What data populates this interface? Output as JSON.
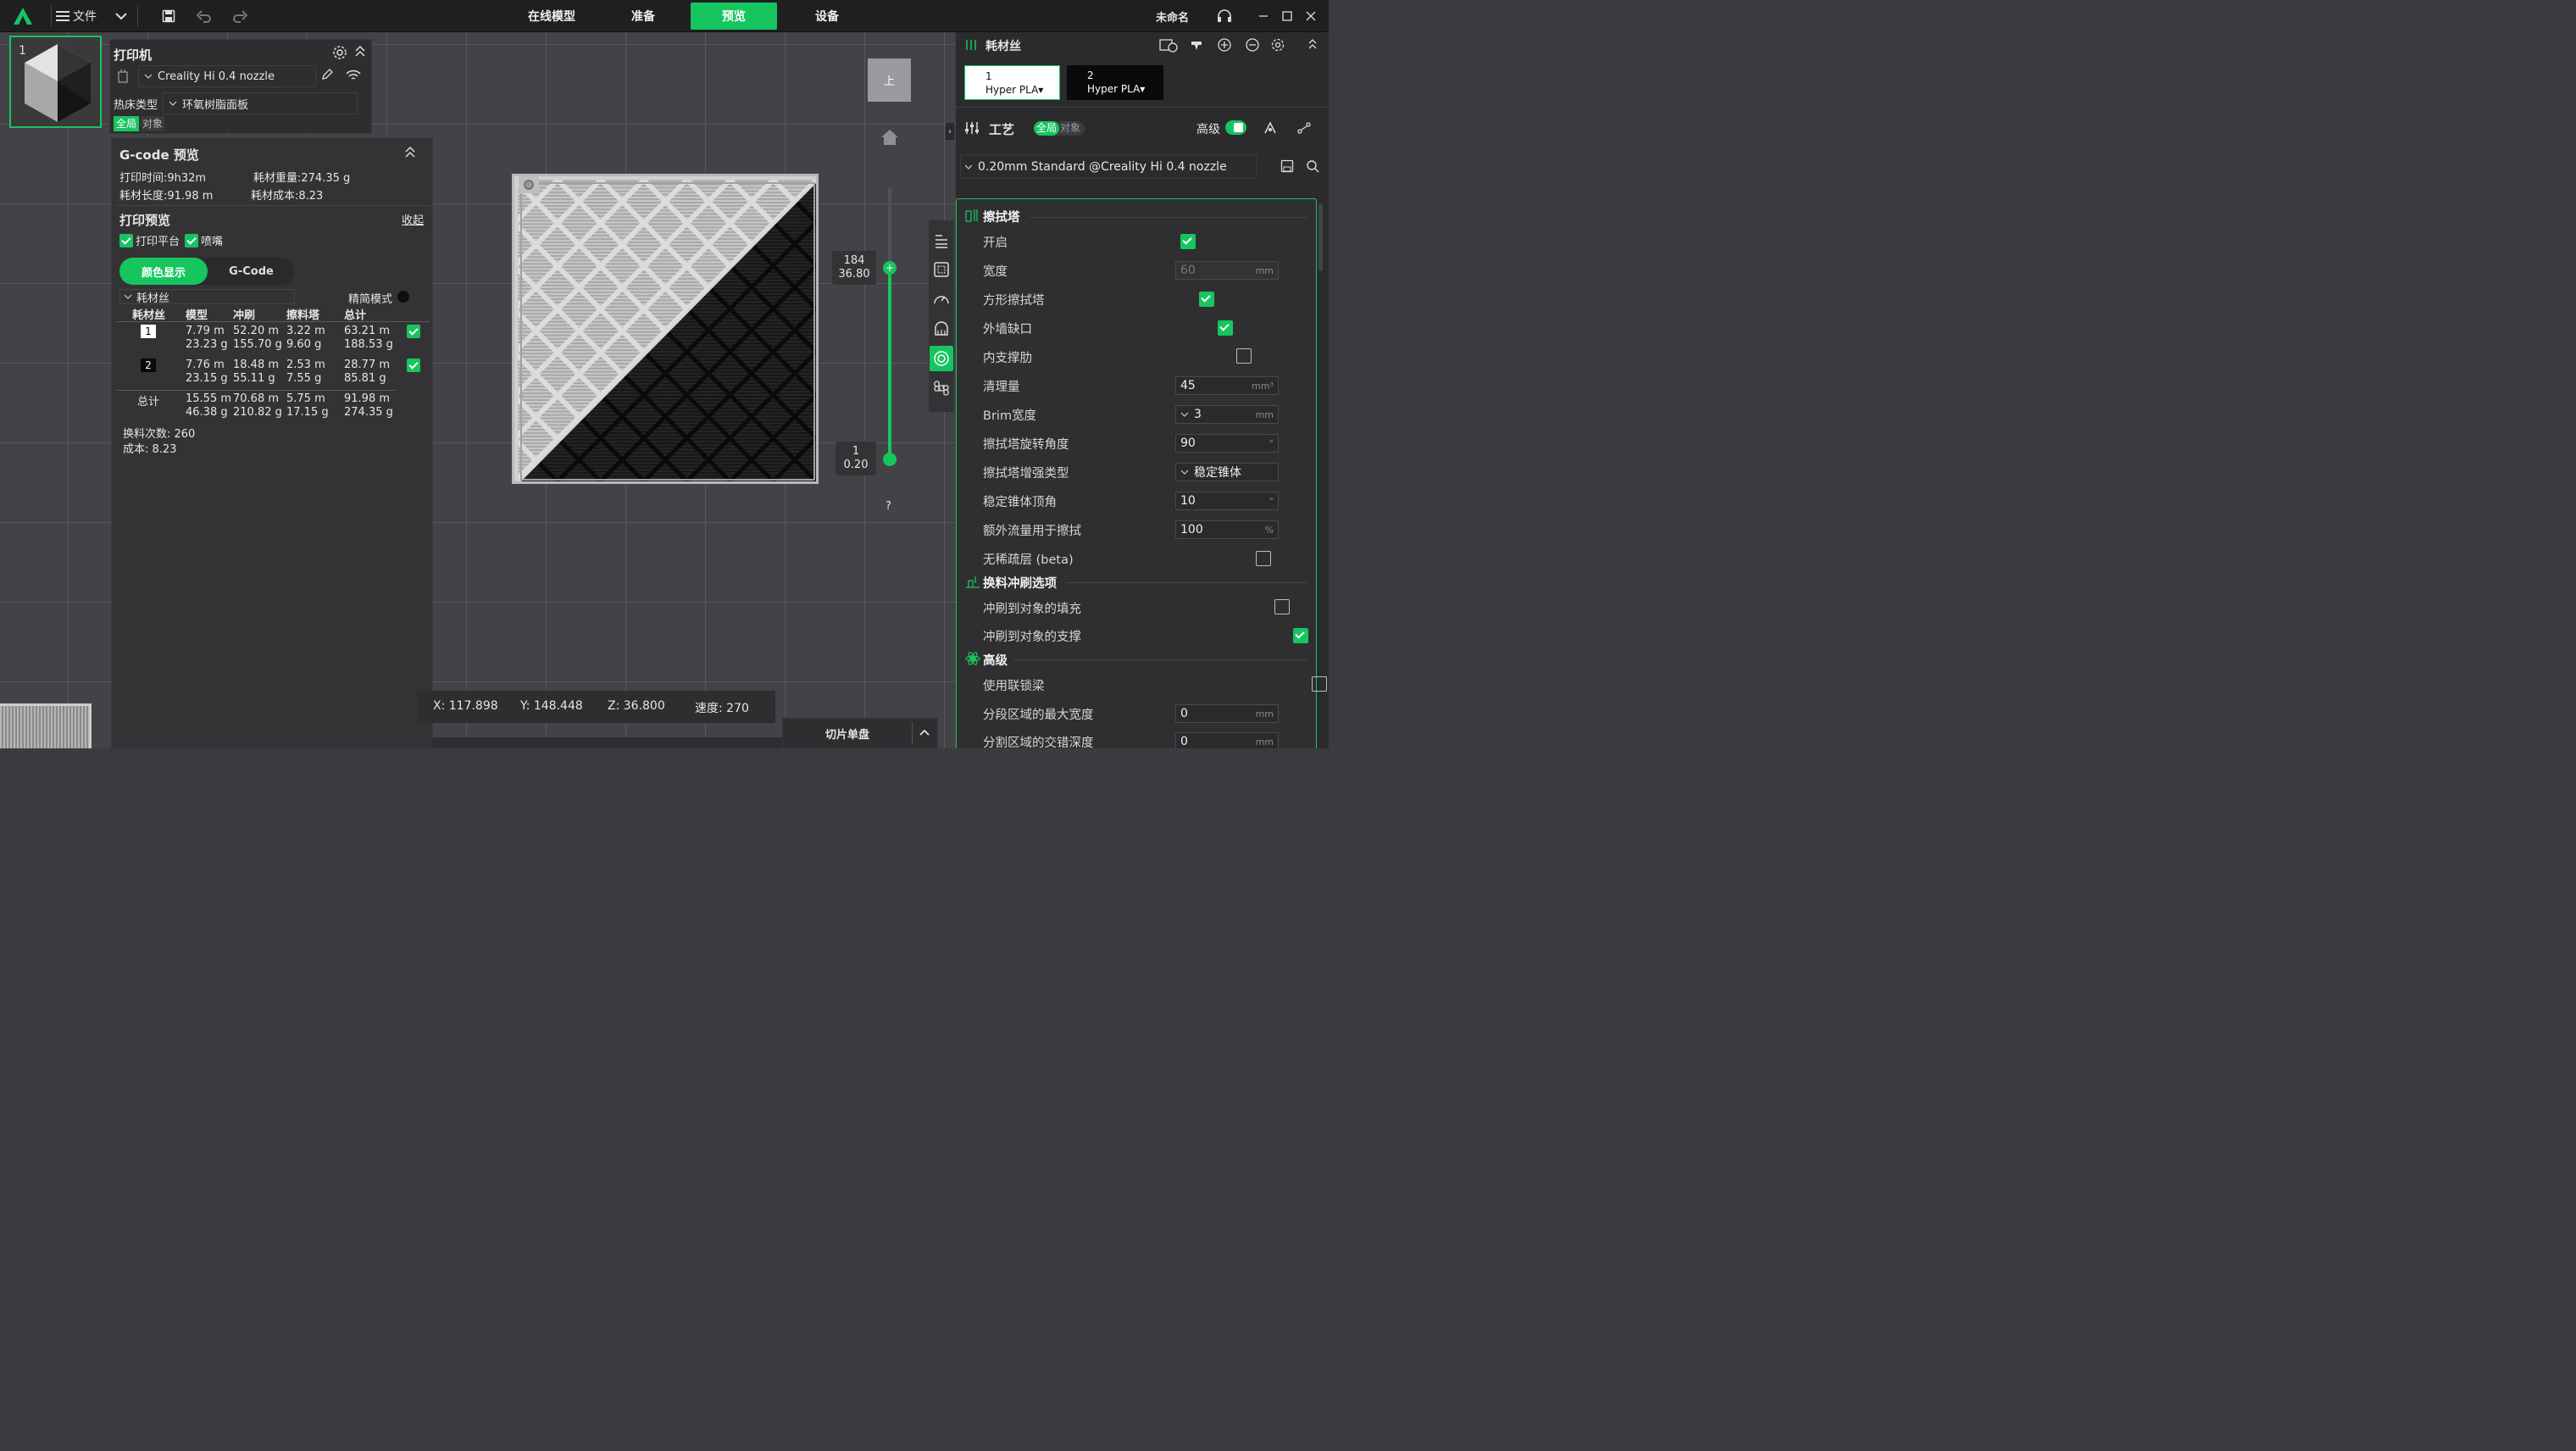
{
  "topbar": {
    "menu_label": "文件",
    "tabs": [
      {
        "label": "在线模型",
        "active": false
      },
      {
        "label": "准备",
        "active": false
      },
      {
        "label": "预览",
        "active": true
      },
      {
        "label": "设备",
        "active": false
      }
    ],
    "project_name": "未命名"
  },
  "plate": {
    "number": "1"
  },
  "printer_panel": {
    "title": "打印机",
    "printer_name": "Creality Hi 0.4 nozzle",
    "bed_type_label": "热床类型",
    "bed_type_value": "环氧树脂面板",
    "scope_global": "全局",
    "scope_object": "对象"
  },
  "gcode_panel": {
    "title": "G-code 预览",
    "print_time": "打印时间:9h32m",
    "filament_weight": "耗材重量:274.35 g",
    "filament_length": "耗材长度:91.98 m",
    "filament_cost": "耗材成本:8.23",
    "preview_title": "打印预览",
    "collapse_label": "收起",
    "show_bed_label": "打印平台",
    "show_nozzle_label": "喷嘴",
    "color_mode_label": "颜色显示",
    "gcode_mode_label": "G-Code",
    "view_type_label": "耗材丝",
    "simple_mode_label": "精简模式",
    "table_headers": [
      "耗材丝",
      "模型",
      "冲刷",
      "擦料塔",
      "总计"
    ],
    "rows": [
      {
        "id": "1",
        "model_len": "7.79 m",
        "model_wt": "23.23 g",
        "flush_len": "52.20 m",
        "flush_wt": "155.70 g",
        "tower_len": "3.22 m",
        "tower_wt": "9.60 g",
        "total_len": "63.21 m",
        "total_wt": "188.53 g",
        "visible": true
      },
      {
        "id": "2",
        "model_len": "7.76 m",
        "model_wt": "23.15 g",
        "flush_len": "18.48 m",
        "flush_wt": "55.11 g",
        "tower_len": "2.53 m",
        "tower_wt": "7.55 g",
        "total_len": "28.77 m",
        "total_wt": "85.81 g",
        "visible": true
      }
    ],
    "total_row": {
      "label": "总计",
      "model_len": "15.55 m",
      "model_wt": "46.38 g",
      "flush_len": "70.68 m",
      "flush_wt": "210.82 g",
      "tower_len": "5.75 m",
      "tower_wt": "17.15 g",
      "total_len": "91.98 m",
      "total_wt": "274.35 g"
    },
    "swaps": "换料次数: 260",
    "cost": "成本: 8.23"
  },
  "view_cube": {
    "label": "上"
  },
  "layer_slider": {
    "top_layer": "184",
    "top_height": "36.80",
    "bottom_layer": "1",
    "bottom_height": "0.20",
    "help": "?"
  },
  "status_bar": {
    "x": "X: 117.898",
    "y": "Y: 148.448",
    "z": "Z: 36.800",
    "speed": "速度: 270"
  },
  "slice_button": {
    "label": "切片单盘"
  },
  "filament_section": {
    "title": "耗材丝",
    "slots": [
      {
        "index": "1",
        "name": "Hyper PLA",
        "color": "#ffffff"
      },
      {
        "index": "2",
        "name": "Hyper PLA",
        "color": "#0a0a0a"
      }
    ]
  },
  "process_section": {
    "title": "工艺",
    "scope_global": "全局",
    "scope_object": "对象",
    "advanced_label": "高级",
    "preset": "0.20mm Standard @Creality Hi 0.4 nozzle"
  },
  "settings": {
    "wipe_tower_title": "擦拭塔",
    "enable": {
      "label": "开启",
      "checked": true
    },
    "width": {
      "label": "宽度",
      "value": "60",
      "unit": "mm"
    },
    "rib_wall": {
      "label": "方形擦拭塔",
      "checked": true
    },
    "outer_gap": {
      "label": "外墙缺口",
      "checked": true
    },
    "inner_rib": {
      "label": "内支撑肋",
      "checked": false
    },
    "purge_volume": {
      "label": "清理量",
      "value": "45",
      "unit": "mm³"
    },
    "brim_width": {
      "label": "Brim宽度",
      "value": "3",
      "unit": "mm"
    },
    "rotation": {
      "label": "擦拭塔旋转角度",
      "value": "90",
      "unit": "°"
    },
    "reinforce_type": {
      "label": "擦拭塔增强类型",
      "value": "稳定锥体"
    },
    "cone_angle": {
      "label": "稳定锥体顶角",
      "value": "10",
      "unit": "°"
    },
    "extra_flow": {
      "label": "额外流量用于擦拭",
      "value": "100",
      "unit": "%"
    },
    "no_sparse": {
      "label": "无稀疏层 (beta)",
      "checked": false
    },
    "flush_title": "换料冲刷选项",
    "flush_infill": {
      "label": "冲刷到对象的填充",
      "checked": false
    },
    "flush_support": {
      "label": "冲刷到对象的支撑",
      "checked": true
    },
    "advanced_title": "高级",
    "interlock": {
      "label": "使用联锁梁",
      "checked": false
    },
    "seg_width": {
      "label": "分段区域的最大宽度",
      "value": "0",
      "unit": "mm"
    },
    "seg_depth": {
      "label": "分割区域的交错深度",
      "value": "0",
      "unit": "mm"
    }
  }
}
